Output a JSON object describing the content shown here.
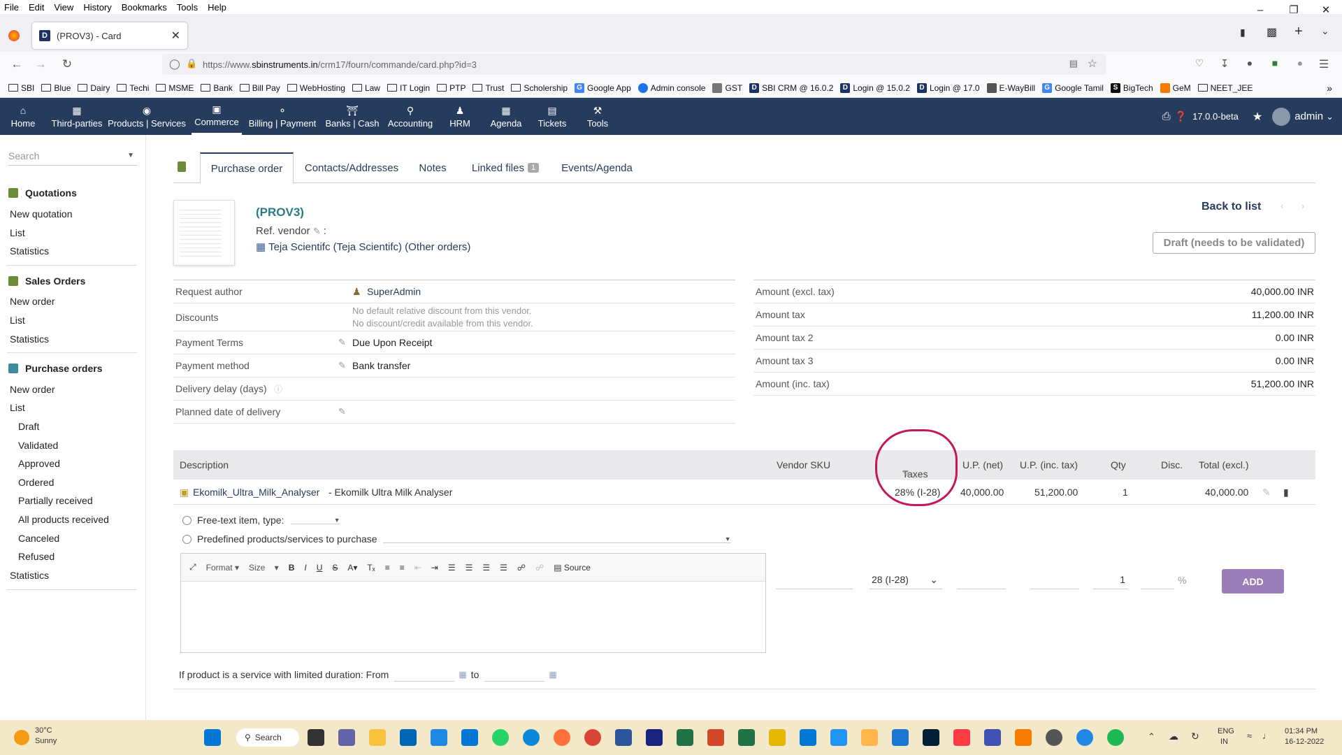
{
  "menubar": [
    "File",
    "Edit",
    "View",
    "History",
    "Bookmarks",
    "Tools",
    "Help"
  ],
  "browser": {
    "tab_title": "(PROV3) - Card",
    "url_prefix": "https://www.",
    "url_host": "sbinstruments.in",
    "url_path": "/crm17/fourn/commande/card.php?id=3"
  },
  "bookmarks": [
    "SBI",
    "Blue",
    "Dairy",
    "Techi",
    "MSME",
    "Bank",
    "Bill Pay",
    "WebHosting",
    "Law",
    "IT Login",
    "PTP",
    "Trust",
    "Scholership",
    "Google App",
    "Admin console",
    "GST",
    "SBI CRM @ 16.0.2",
    "Login @ 15.0.2",
    "Login @ 17.0",
    "E-WayBill",
    "Google Tamil",
    "BigTech",
    "GeM",
    "NEET_JEE"
  ],
  "topmenu": [
    "Home",
    "Third-parties",
    "Products | Services",
    "Commerce",
    "Billing | Payment",
    "Banks | Cash",
    "Accounting",
    "HRM",
    "Agenda",
    "Tickets",
    "Tools"
  ],
  "topright": {
    "version": "17.0.0-beta",
    "user": "admin"
  },
  "leftpanel": {
    "search_placeholder": "Search",
    "quotations": {
      "title": "Quotations",
      "items": [
        "New quotation",
        "List",
        "Statistics"
      ]
    },
    "sales": {
      "title": "Sales Orders",
      "items": [
        "New order",
        "List",
        "Statistics"
      ]
    },
    "purchase": {
      "title": "Purchase orders",
      "items": [
        "New order",
        "List"
      ],
      "subitems": [
        "Draft",
        "Validated",
        "Approved",
        "Ordered",
        "Partially received",
        "All products received",
        "Canceled",
        "Refused"
      ],
      "last": "Statistics"
    }
  },
  "tabs": {
    "purchase_order": "Purchase order",
    "contacts": "Contacts/Addresses",
    "notes": "Notes",
    "linked": "Linked files",
    "linked_count": "1",
    "events": "Events/Agenda"
  },
  "header": {
    "ref": "(PROV3)",
    "ref_vendor": "Ref. vendor",
    "ref_colon": ":",
    "vendor": "Teja Scientifc (Teja Scientifc)",
    "other_orders": "(Other orders)",
    "back_to_list": "Back to list",
    "status": "Draft (needs to be validated)"
  },
  "fields": {
    "request_author_label": "Request author",
    "request_author": "SuperAdmin",
    "discounts_label": "Discounts",
    "discount_1": "No default relative discount from this vendor.",
    "discount_2": "No discount/credit available from this vendor.",
    "payment_terms_label": "Payment Terms",
    "payment_terms": "Due Upon Receipt",
    "payment_method_label": "Payment method",
    "payment_method": "Bank transfer",
    "delivery_delay_label": "Delivery delay (days)",
    "planned_date_label": "Planned date of delivery"
  },
  "amounts": {
    "excl_label": "Amount (excl. tax)",
    "excl": "40,000.00 INR",
    "tax_label": "Amount tax",
    "tax": "11,200.00 INR",
    "tax2_label": "Amount tax 2",
    "tax2": "0.00 INR",
    "tax3_label": "Amount tax 3",
    "tax3": "0.00 INR",
    "inc_label": "Amount (inc. tax)",
    "inc": "51,200.00 INR"
  },
  "table": {
    "headers": {
      "description": "Description",
      "vendor_sku": "Vendor SKU",
      "taxes": "Taxes",
      "up_net": "U.P. (net)",
      "up_inc": "U.P. (inc. tax)",
      "qty": "Qty",
      "disc": "Disc.",
      "total": "Total (excl.)"
    },
    "row": {
      "product_ref": "Ekomilk_Ultra_Milk_Analyser",
      "product_label": "- Ekomilk Ultra Milk Analyser",
      "taxes": "28% (I-28)",
      "up_net": "40,000.00",
      "up_inc": "51,200.00",
      "qty": "1",
      "total": "40,000.00"
    }
  },
  "addline": {
    "freetext": "Free-text item, type:",
    "predefined": "Predefined products/services to purchase",
    "editor_format": "Format",
    "editor_size": "Size",
    "editor_source": "Source",
    "tax_select": "28 (I-28)",
    "qty": "1",
    "percent": "%",
    "add": "ADD",
    "service_label": "If product is a service with limited duration: From",
    "to": "to"
  },
  "taskbar": {
    "temp": "30°C",
    "weather": "Sunny",
    "search": "Search",
    "lang1": "ENG",
    "lang2": "IN",
    "time": "01:34 PM",
    "date": "16-12-2022"
  },
  "colors": {
    "topmenu": "#263c5c",
    "add_button": "#9b7eb9",
    "annotation": "#c2185b"
  }
}
